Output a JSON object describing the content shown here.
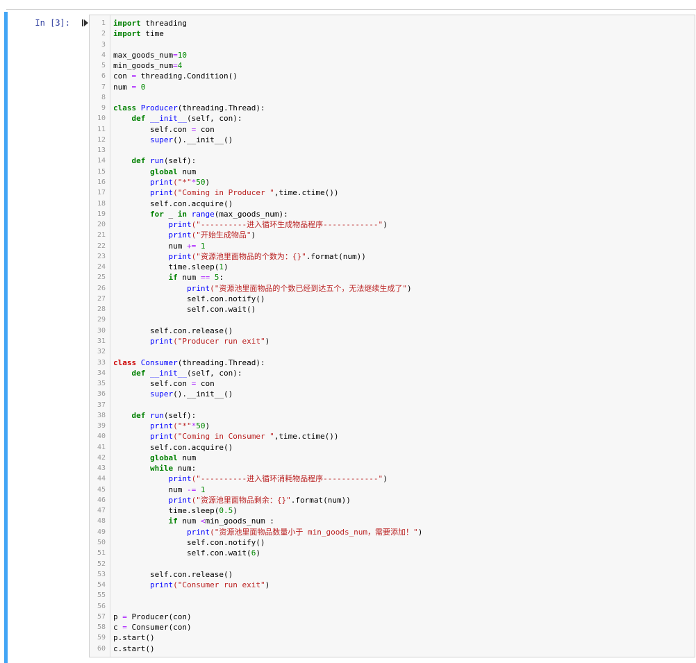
{
  "cell": {
    "prompt": "In  [3]:",
    "run_icon": "run-cell-icon",
    "lines": [
      [
        {
          "t": "import",
          "c": "kw"
        },
        {
          "t": " threading"
        }
      ],
      [
        {
          "t": "import",
          "c": "kw"
        },
        {
          "t": " time"
        }
      ],
      [],
      [
        {
          "t": "max_goods_num"
        },
        {
          "t": "=",
          "c": "op"
        },
        {
          "t": "10",
          "c": "num"
        }
      ],
      [
        {
          "t": "min_goods_num"
        },
        {
          "t": "=",
          "c": "op"
        },
        {
          "t": "4",
          "c": "num"
        }
      ],
      [
        {
          "t": "con "
        },
        {
          "t": "=",
          "c": "op"
        },
        {
          "t": " threading.Condition()"
        }
      ],
      [
        {
          "t": "num "
        },
        {
          "t": "=",
          "c": "op"
        },
        {
          "t": " "
        },
        {
          "t": "0",
          "c": "num"
        }
      ],
      [],
      [
        {
          "t": "class",
          "c": "kw"
        },
        {
          "t": " "
        },
        {
          "t": "Producer",
          "c": "def"
        },
        {
          "t": "(threading.Thread):"
        }
      ],
      [
        {
          "t": "    "
        },
        {
          "t": "def",
          "c": "kw"
        },
        {
          "t": " "
        },
        {
          "t": "__init__",
          "c": "def"
        },
        {
          "t": "(self, con):"
        }
      ],
      [
        {
          "t": "        self.con "
        },
        {
          "t": "=",
          "c": "op"
        },
        {
          "t": " con"
        }
      ],
      [
        {
          "t": "        "
        },
        {
          "t": "super",
          "c": "bi"
        },
        {
          "t": "().__init__()"
        }
      ],
      [],
      [
        {
          "t": "    "
        },
        {
          "t": "def",
          "c": "kw"
        },
        {
          "t": " "
        },
        {
          "t": "run",
          "c": "def"
        },
        {
          "t": "(self):"
        }
      ],
      [
        {
          "t": "        "
        },
        {
          "t": "global",
          "c": "kw"
        },
        {
          "t": " num"
        }
      ],
      [
        {
          "t": "        "
        },
        {
          "t": "print",
          "c": "bi"
        },
        {
          "t": "(\"*\"",
          "c": "str"
        },
        {
          "t": "*",
          "c": "op"
        },
        {
          "t": "50",
          "c": "num"
        },
        {
          "t": ")"
        }
      ],
      [
        {
          "t": "        "
        },
        {
          "t": "print",
          "c": "bi"
        },
        {
          "t": "(\"Coming in Producer \"",
          "c": "str"
        },
        {
          "t": ",time.ctime())"
        }
      ],
      [
        {
          "t": "        self.con.acquire()"
        }
      ],
      [
        {
          "t": "        "
        },
        {
          "t": "for",
          "c": "kw"
        },
        {
          "t": " _ "
        },
        {
          "t": "in",
          "c": "kw"
        },
        {
          "t": " "
        },
        {
          "t": "range",
          "c": "bi"
        },
        {
          "t": "(max_goods_num):"
        }
      ],
      [
        {
          "t": "            "
        },
        {
          "t": "print",
          "c": "bi"
        },
        {
          "t": "(\"----------进入循环生成物品程序------------\"",
          "c": "str"
        },
        {
          "t": ")"
        }
      ],
      [
        {
          "t": "            "
        },
        {
          "t": "print",
          "c": "bi"
        },
        {
          "t": "(\"开始生成物品\"",
          "c": "str"
        },
        {
          "t": ")"
        }
      ],
      [
        {
          "t": "            num "
        },
        {
          "t": "+=",
          "c": "op"
        },
        {
          "t": " "
        },
        {
          "t": "1",
          "c": "num"
        }
      ],
      [
        {
          "t": "            "
        },
        {
          "t": "print",
          "c": "bi"
        },
        {
          "t": "(\"资源池里面物品的个数为：{}\"",
          "c": "str"
        },
        {
          "t": ".format(num))"
        }
      ],
      [
        {
          "t": "            time.sleep("
        },
        {
          "t": "1",
          "c": "num"
        },
        {
          "t": ")"
        }
      ],
      [
        {
          "t": "            "
        },
        {
          "t": "if",
          "c": "kw"
        },
        {
          "t": " num "
        },
        {
          "t": "==",
          "c": "op"
        },
        {
          "t": " "
        },
        {
          "t": "5",
          "c": "num"
        },
        {
          "t": ":"
        }
      ],
      [
        {
          "t": "                "
        },
        {
          "t": "print",
          "c": "bi"
        },
        {
          "t": "(\"资源池里面物品的个数已经到达五个，无法继续生成了\"",
          "c": "str"
        },
        {
          "t": ")"
        }
      ],
      [
        {
          "t": "                self.con.notify()"
        }
      ],
      [
        {
          "t": "                self.con.wait()"
        }
      ],
      [],
      [
        {
          "t": "        self.con.release()"
        }
      ],
      [
        {
          "t": "        "
        },
        {
          "t": "print",
          "c": "bi"
        },
        {
          "t": "(\"Producer run exit\"",
          "c": "str"
        },
        {
          "t": ")"
        }
      ],
      [],
      [
        {
          "t": "class",
          "c": "kwr"
        },
        {
          "t": " "
        },
        {
          "t": "Consumer",
          "c": "def"
        },
        {
          "t": "(threading.Thread):"
        }
      ],
      [
        {
          "t": "    "
        },
        {
          "t": "def",
          "c": "kw"
        },
        {
          "t": " "
        },
        {
          "t": "__init__",
          "c": "def"
        },
        {
          "t": "(self, con):"
        }
      ],
      [
        {
          "t": "        self.con "
        },
        {
          "t": "=",
          "c": "op"
        },
        {
          "t": " con"
        }
      ],
      [
        {
          "t": "        "
        },
        {
          "t": "super",
          "c": "bi"
        },
        {
          "t": "().__init__()"
        }
      ],
      [],
      [
        {
          "t": "    "
        },
        {
          "t": "def",
          "c": "kw"
        },
        {
          "t": " "
        },
        {
          "t": "run",
          "c": "def"
        },
        {
          "t": "(self):"
        }
      ],
      [
        {
          "t": "        "
        },
        {
          "t": "print",
          "c": "bi"
        },
        {
          "t": "(\"*\"",
          "c": "str"
        },
        {
          "t": "*",
          "c": "op"
        },
        {
          "t": "50",
          "c": "num"
        },
        {
          "t": ")"
        }
      ],
      [
        {
          "t": "        "
        },
        {
          "t": "print",
          "c": "bi"
        },
        {
          "t": "(\"Coming in Consumer \"",
          "c": "str"
        },
        {
          "t": ",time.ctime())"
        }
      ],
      [
        {
          "t": "        self.con.acquire()"
        }
      ],
      [
        {
          "t": "        "
        },
        {
          "t": "global",
          "c": "kw"
        },
        {
          "t": " num"
        }
      ],
      [
        {
          "t": "        "
        },
        {
          "t": "while",
          "c": "kw"
        },
        {
          "t": " num:"
        }
      ],
      [
        {
          "t": "            "
        },
        {
          "t": "print",
          "c": "bi"
        },
        {
          "t": "(\"----------进入循环消耗物品程序------------\"",
          "c": "str"
        },
        {
          "t": ")"
        }
      ],
      [
        {
          "t": "            num "
        },
        {
          "t": "-=",
          "c": "op"
        },
        {
          "t": " "
        },
        {
          "t": "1",
          "c": "num"
        }
      ],
      [
        {
          "t": "            "
        },
        {
          "t": "print",
          "c": "bi"
        },
        {
          "t": "(\"资源池里面物品剩余：{}\"",
          "c": "str"
        },
        {
          "t": ".format(num))"
        }
      ],
      [
        {
          "t": "            time.sleep("
        },
        {
          "t": "0.5",
          "c": "num"
        },
        {
          "t": ")"
        }
      ],
      [
        {
          "t": "            "
        },
        {
          "t": "if",
          "c": "kw"
        },
        {
          "t": " num "
        },
        {
          "t": "<",
          "c": "op"
        },
        {
          "t": "min_goods_num :"
        }
      ],
      [
        {
          "t": "                "
        },
        {
          "t": "print",
          "c": "bi"
        },
        {
          "t": "(\"资源池里面物品数量小于 min_goods_num，需要添加！\"",
          "c": "str"
        },
        {
          "t": ")"
        }
      ],
      [
        {
          "t": "                self.con.notify()"
        }
      ],
      [
        {
          "t": "                self.con.wait("
        },
        {
          "t": "6",
          "c": "num"
        },
        {
          "t": ")"
        }
      ],
      [],
      [
        {
          "t": "        self.con.release()"
        }
      ],
      [
        {
          "t": "        "
        },
        {
          "t": "print",
          "c": "bi"
        },
        {
          "t": "(\"Consumer run exit\"",
          "c": "str"
        },
        {
          "t": ")"
        }
      ],
      [],
      [],
      [
        {
          "t": "p "
        },
        {
          "t": "=",
          "c": "op"
        },
        {
          "t": " Producer(con)"
        }
      ],
      [
        {
          "t": "c "
        },
        {
          "t": "=",
          "c": "op"
        },
        {
          "t": " Consumer(con)"
        }
      ],
      [
        {
          "t": "p.start()"
        }
      ],
      [
        {
          "t": "c.start()"
        }
      ]
    ]
  }
}
